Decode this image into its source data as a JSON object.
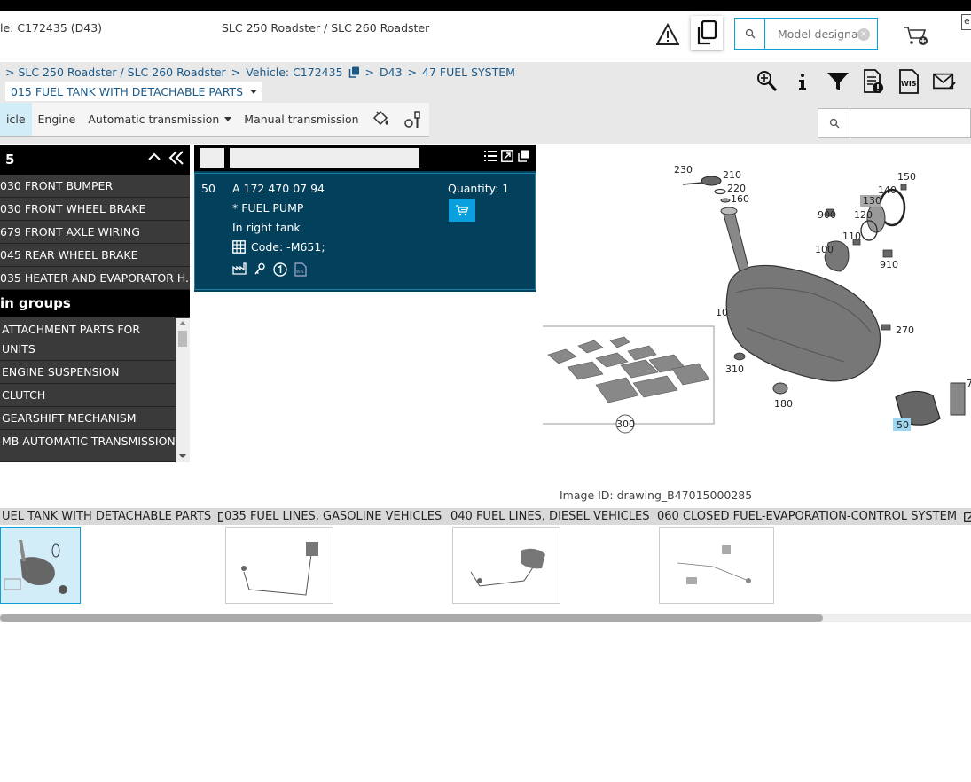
{
  "header": {
    "vehicle": "le: C172435 (D43)",
    "model": "SLC 250 Roadster / SLC 260 Roadster",
    "search_placeholder": "Model designati",
    "lang": "e"
  },
  "breadcrumb": {
    "items": [
      "> SLC 250 Roadster / SLC 260 Roadster",
      ">",
      "Vehicle: C172435",
      ">",
      "D43",
      ">",
      "47 FUEL SYSTEM"
    ],
    "subgroup": "015 FUEL TANK WITH DETACHABLE PARTS"
  },
  "tabs": [
    {
      "label": "icle"
    },
    {
      "label": "Engine"
    },
    {
      "label": "Automatic transmission"
    },
    {
      "label": "Manual transmission"
    }
  ],
  "left_panel": {
    "title": "5",
    "recent": [
      "030 FRONT BUMPER",
      "030 FRONT WHEEL BRAKE",
      "679 FRONT AXLE WIRING",
      "045 REAR WHEEL BRAKE",
      "035 HEATER AND EVAPORATOR H..."
    ],
    "section_title": "in groups",
    "groups": [
      "ATTACHMENT PARTS FOR UNITS",
      "ENGINE SUSPENSION",
      "CLUTCH",
      "GEARSHIFT MECHANISM",
      "MB AUTOMATIC TRANSMISSION"
    ]
  },
  "part": {
    "position": "50",
    "number": "A 172 470 07 94",
    "name": "* FUEL PUMP",
    "note": "In right tank",
    "code": "Code: -M651;",
    "quantity": "Quantity: 1"
  },
  "drawing": {
    "labels": [
      "230",
      "210",
      "220",
      "160",
      "150",
      "140",
      "130",
      "900",
      "120",
      "110",
      "100",
      "910",
      "10",
      "270",
      "310",
      "180",
      "300",
      "50",
      "7"
    ],
    "image_id": "Image ID: drawing_B47015000285"
  },
  "thumbnails": [
    {
      "label": "UEL TANK WITH DETACHABLE PARTS"
    },
    {
      "label": "035 FUEL LINES, GASOLINE VEHICLES"
    },
    {
      "label": "040 FUEL LINES, DIESEL VEHICLES"
    },
    {
      "label": "060 CLOSED FUEL-EVAPORATION-CONTROL SYSTEM"
    }
  ],
  "colors": {
    "accent": "#0aa0d8",
    "part_panel": "#00425e",
    "dark_panel": "#3a3a3a"
  }
}
